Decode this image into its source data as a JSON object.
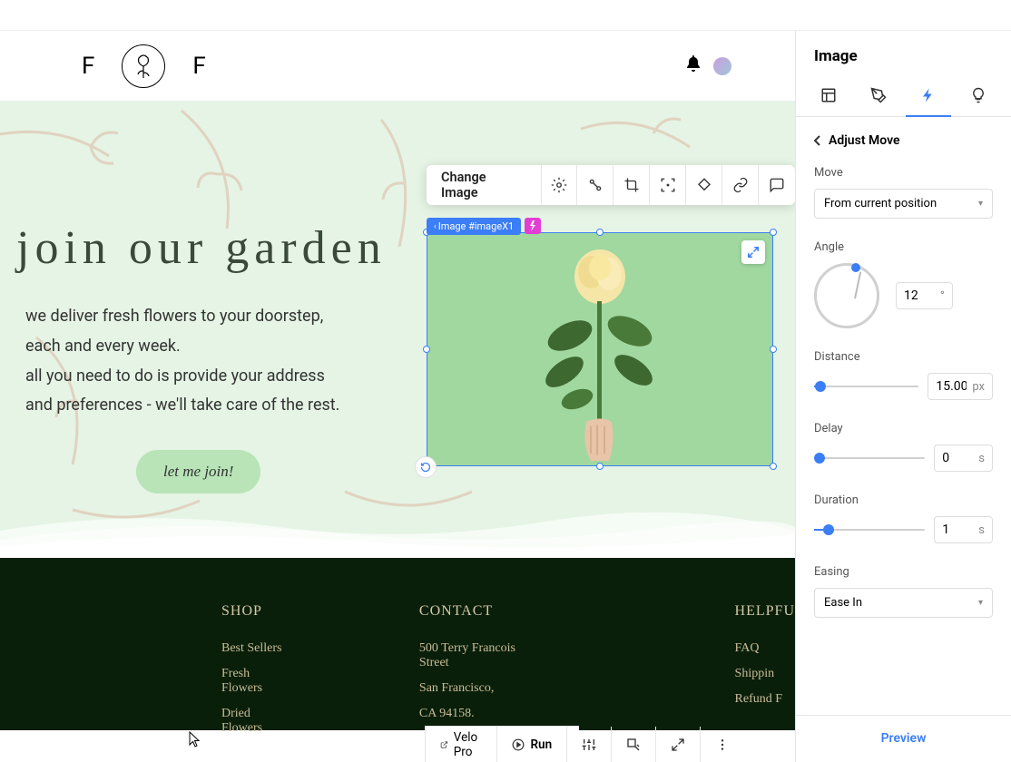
{
  "panel": {
    "title": "Image",
    "back_label": "Adjust Move",
    "move": {
      "label": "Move",
      "value": "From current position"
    },
    "angle": {
      "label": "Angle",
      "value": "12",
      "unit": "°"
    },
    "distance": {
      "label": "Distance",
      "value": "15.00",
      "unit": "px"
    },
    "delay": {
      "label": "Delay",
      "value": "0",
      "unit": "s"
    },
    "duration": {
      "label": "Duration",
      "value": "1",
      "unit": "s"
    },
    "easing": {
      "label": "Easing",
      "value": "Ease In"
    },
    "preview": "Preview"
  },
  "toolbar": {
    "change_image": "Change Image"
  },
  "selection": {
    "label": "Image #imageX1"
  },
  "hero": {
    "title": "join our garden",
    "line1": "we deliver fresh flowers to your doorstep,",
    "line2": "each and every week.",
    "line3": "all you need to do is provide your address",
    "line4": "and preferences - we'll take care of the rest.",
    "cta": "let me join!"
  },
  "footer": {
    "shop": {
      "title": "SHOP",
      "items": [
        "Best Sellers",
        "Fresh Flowers",
        "Dried Flowers"
      ]
    },
    "contact": {
      "title": "CONTACT",
      "line1": "500 Terry Francois Street",
      "line2": "San Francisco,",
      "line3": "CA 94158."
    },
    "helpful": {
      "title": "HELPFU",
      "items": [
        "FAQ",
        "Shippin",
        "Refund F"
      ]
    }
  },
  "bottom_bar": {
    "velo": "Velo Pro",
    "run": "Run"
  },
  "logo": {
    "left": "F",
    "right": "F"
  }
}
